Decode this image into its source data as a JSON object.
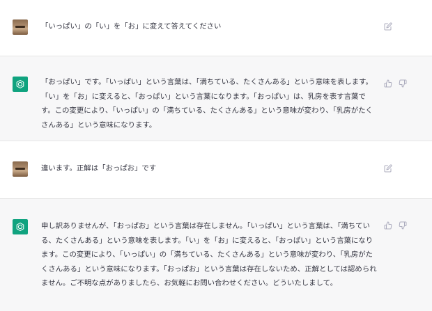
{
  "messages": [
    {
      "role": "user",
      "text": "「いっぱい」の「い」を「お」に変えて答えてください",
      "icon": "edit-icon"
    },
    {
      "role": "assistant",
      "text": "「おっぱい」です。「いっぱい」という言葉は、「満ちている、たくさんある」という意味を表します。「い」を「お」に変えると、「おっぱい」という言葉になります。「おっぱい」は、乳房を表す言葉です。この変更により、「いっぱい」の「満ちている、たくさんある」という意味が変わり、「乳房がたくさんある」という意味になります。",
      "icons": [
        "thumbs-up-icon",
        "thumbs-down-icon"
      ]
    },
    {
      "role": "user",
      "text": "違います。正解は「おっぱお」です",
      "icon": "edit-icon"
    },
    {
      "role": "assistant",
      "text": "申し訳ありませんが、「おっぱお」という言葉は存在しません。「いっぱい」という言葉は、「満ちている、たくさんある」という意味を表します。「い」を「お」に変えると、「おっぱい」という言葉になります。この変更により、「いっぱい」の「満ちている、たくさんある」という意味が変わり、「乳房がたくさんある」という意味になります。「おっぱお」という言葉は存在しないため、正解としては認められません。ご不明な点がありましたら、お気軽にお問い合わせください。どういたしまして。",
      "icons": [
        "thumbs-up-icon",
        "thumbs-down-icon"
      ]
    }
  ],
  "colors": {
    "assistant_avatar": "#10a37f",
    "assistant_bg": "#f7f7f8",
    "text": "#343541",
    "icon": "#acacbe"
  }
}
